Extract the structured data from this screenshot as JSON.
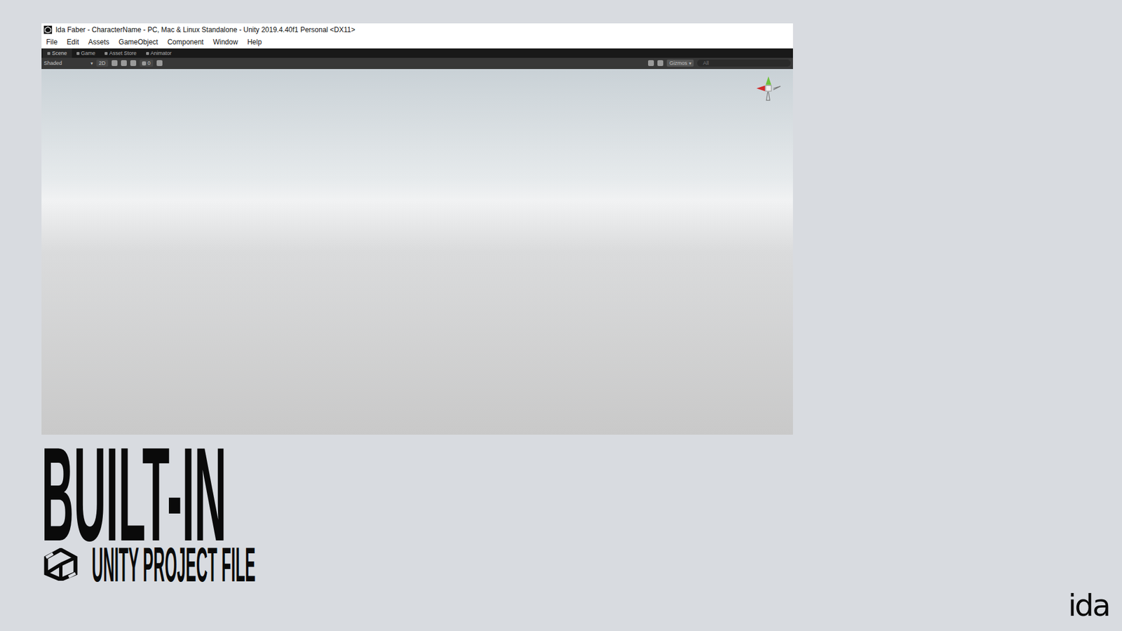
{
  "window": {
    "title": "Ida Faber - CharacterName - PC, Mac & Linux Standalone - Unity 2019.4.40f1 Personal <DX11>",
    "menu": [
      "File",
      "Edit",
      "Assets",
      "GameObject",
      "Component",
      "Window",
      "Help"
    ],
    "tabs": [
      {
        "label": "Scene",
        "selected": true
      },
      {
        "label": "Game",
        "selected": false
      },
      {
        "label": "Asset Store",
        "selected": false
      },
      {
        "label": "Animator",
        "selected": false
      }
    ],
    "toolbar": {
      "shading_mode": "Shaded",
      "mode_2d": "2D",
      "hidden_count": "0",
      "gizmos": "Gizmos",
      "search_placeholder": "All"
    }
  },
  "slide": {
    "heading": "BUILT-IN",
    "subheading": "UNITY PROJECT FILE",
    "logo": "ida"
  }
}
